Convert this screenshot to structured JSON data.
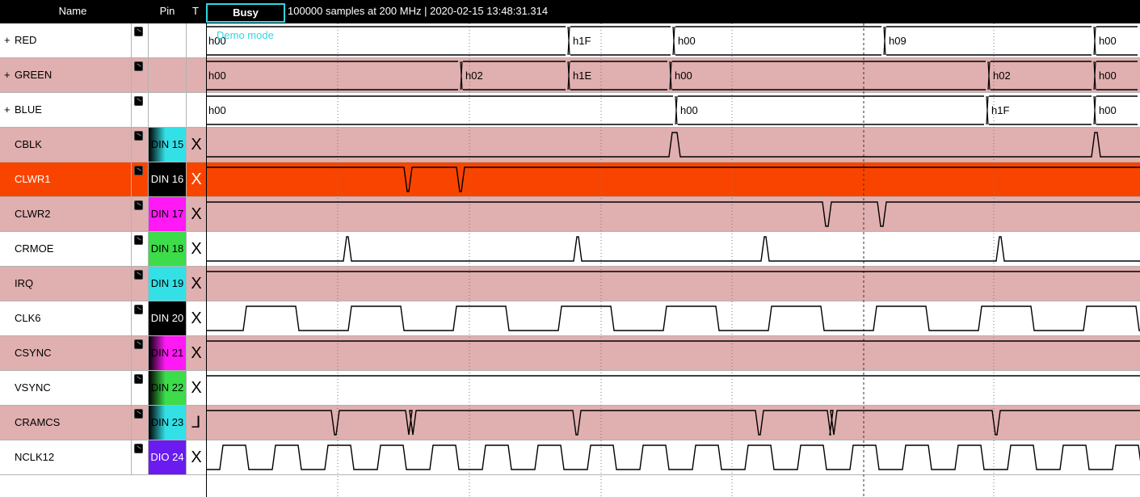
{
  "header": {
    "name_col": "Name",
    "pin_col": "Pin",
    "trigger_col": "T",
    "busy_label": "Busy",
    "status_text": "100000 samples at 200 MHz | 2020-02-15 13:48:31.314"
  },
  "demo_label": "Demo mode",
  "colors": {
    "pink": "#e0afaf",
    "highlight": "#f94400",
    "accent": "#2fd6df"
  },
  "channels": [
    {
      "name": "RED",
      "expandable": "+",
      "pin": "",
      "trigger": "",
      "bg": "white",
      "pin_colors": []
    },
    {
      "name": "GREEN",
      "expandable": "+",
      "pin": "",
      "trigger": "",
      "bg": "pink",
      "pin_colors": []
    },
    {
      "name": "BLUE",
      "expandable": "+",
      "pin": "",
      "trigger": "",
      "bg": "white",
      "pin_colors": []
    },
    {
      "name": "CBLK",
      "expandable": "",
      "pin": "DIN 15",
      "trigger": "X",
      "bg": "pink",
      "pin_colors": [
        "#000000",
        "#33e0e6"
      ]
    },
    {
      "name": "CLWR1",
      "expandable": "",
      "pin": "DIN 16",
      "trigger": "X",
      "bg": "orange",
      "pin_colors": [
        "#000000",
        "#000000"
      ]
    },
    {
      "name": "CLWR2",
      "expandable": "",
      "pin": "DIN 17",
      "trigger": "X",
      "bg": "pink",
      "pin_colors": [
        "#ff19f5",
        "#ff19f5"
      ]
    },
    {
      "name": "CRMOE",
      "expandable": "",
      "pin": "DIN 18",
      "trigger": "X",
      "bg": "white",
      "pin_colors": [
        "#3ddc4a",
        "#3ddc4a"
      ]
    },
    {
      "name": "IRQ",
      "expandable": "",
      "pin": "DIN 19",
      "trigger": "X",
      "bg": "pink",
      "pin_colors": [
        "#33e0e6",
        "#33e0e6"
      ]
    },
    {
      "name": "CLK6",
      "expandable": "",
      "pin": "DIN 20",
      "trigger": "X",
      "bg": "white",
      "pin_colors": [
        "#000000",
        "#000000"
      ]
    },
    {
      "name": "CSYNC",
      "expandable": "",
      "pin": "DIN 21",
      "trigger": "X",
      "bg": "pink",
      "pin_colors": [
        "#000000",
        "#ff19f5"
      ]
    },
    {
      "name": "VSYNC",
      "expandable": "",
      "pin": "DIN 22",
      "trigger": "X",
      "bg": "white",
      "pin_colors": [
        "#000000",
        "#3ddc4a"
      ]
    },
    {
      "name": "CRAMCS",
      "expandable": "",
      "pin": "DIN 23",
      "trigger": "⅃",
      "bg": "pink",
      "pin_colors": [
        "#000000",
        "#33e0e6"
      ]
    },
    {
      "name": "NCLK12",
      "expandable": "",
      "pin": "DIO 24",
      "trigger": "X",
      "bg": "white",
      "pin_colors": [
        "#6a1cf0",
        "#6a1cf0"
      ]
    }
  ],
  "bus_values": {
    "RED": [
      "h00",
      "h1F",
      "h00",
      "h09",
      "h00"
    ],
    "GREEN": [
      "h00",
      "h02",
      "h1E",
      "h00",
      "h02",
      "h00"
    ],
    "BLUE": [
      "h00",
      "h00",
      "h1F",
      "h00"
    ]
  }
}
